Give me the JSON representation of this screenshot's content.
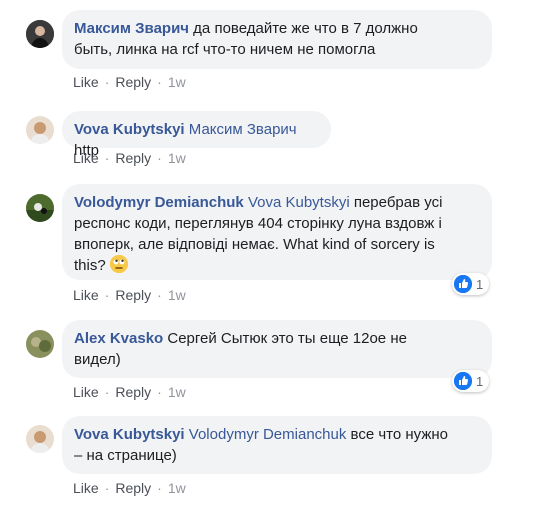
{
  "action_labels": {
    "like": "Like",
    "reply": "Reply",
    "sep": "·"
  },
  "comments": [
    {
      "author": "Максим Зварич",
      "mention": "",
      "line1": " да поведайте же что в 7 должно",
      "line2": "быть, линка на rcf что-то ничем не помогла",
      "time": "1w"
    },
    {
      "author": "Vova Kubytskyi",
      "mention": "Максим Зварич",
      "line1": " http",
      "time": "1w"
    },
    {
      "author": "Volodymyr Demianchuk",
      "mention": "Vova Kubytskyi",
      "line1": " перебрав усі",
      "line2": "респонс коди, переглянув 404 сторінку луна вздовж і",
      "line3": "впоперк, але відповіді немає. What kind of sorcery is",
      "line4": "this?",
      "time": "1w",
      "reaction_count": "1"
    },
    {
      "author": "Alex Kvasko",
      "mention": "",
      "line1": " Сергей Сытюк это ты еще 12ое не",
      "line2": "видел)",
      "time": "1w",
      "reaction_count": "1"
    },
    {
      "author": "Vova Kubytskyi",
      "mention": "Volodymyr Demianchuk",
      "line1": " все что нужно",
      "line2": "– на странице)",
      "time": "1w"
    }
  ]
}
